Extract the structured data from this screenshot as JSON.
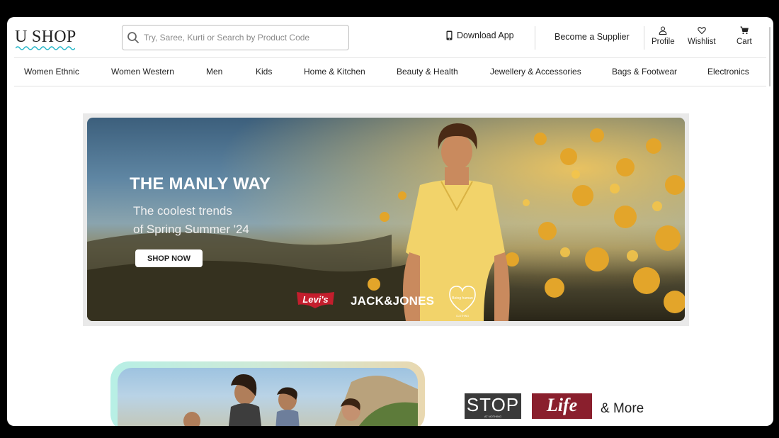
{
  "app": {
    "logo": "U SHOP"
  },
  "search": {
    "placeholder": "Try, Saree, Kurti or Search by Product Code",
    "value": ""
  },
  "header": {
    "download_app": "Download App",
    "become_supplier": "Become a Supplier",
    "profile": "Profile",
    "wishlist": "Wishlist",
    "cart": "Cart"
  },
  "nav": {
    "items": [
      {
        "label": "Women Ethnic"
      },
      {
        "label": "Women Western"
      },
      {
        "label": "Men"
      },
      {
        "label": "Kids"
      },
      {
        "label": "Home & Kitchen"
      },
      {
        "label": "Beauty & Health"
      },
      {
        "label": "Jewellery & Accessories"
      },
      {
        "label": "Bags & Footwear"
      },
      {
        "label": "Electronics"
      }
    ]
  },
  "banner": {
    "title": "THE MANLY WAY",
    "subtitle_line1": "The coolest trends",
    "subtitle_line2": "of Spring Summer '24",
    "cta": "SHOP NOW",
    "brands": {
      "levis": "Levi's",
      "jack_jones": "JACK&JONES",
      "being_human": "Being human",
      "being_human_sub": "CLOTHING"
    }
  },
  "lower": {
    "brand_stop": "STOP",
    "brand_stop_sub": "AT NOTHING",
    "brand_life": "Life",
    "more": "& More"
  },
  "colors": {
    "accent": "#1fb5c7",
    "life_brand": "#8a1f2d",
    "stop_brand": "#3a3a3a",
    "levis_red": "#c41e2d"
  },
  "icons": [
    "search-icon",
    "phone-icon",
    "profile-icon",
    "heart-icon",
    "cart-icon"
  ]
}
